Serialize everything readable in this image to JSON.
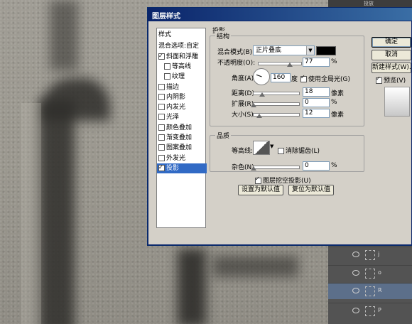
{
  "dialog": {
    "title": "图层样式"
  },
  "style_list": [
    {
      "label": "样式",
      "checkbox": false,
      "checked": false,
      "selected": false,
      "indent": false
    },
    {
      "label": "混合选项:自定",
      "checkbox": false,
      "checked": false,
      "selected": false,
      "indent": false
    },
    {
      "label": "斜面和浮雕",
      "checkbox": true,
      "checked": true,
      "selected": false,
      "indent": false
    },
    {
      "label": "等高线",
      "checkbox": true,
      "checked": false,
      "selected": false,
      "indent": true
    },
    {
      "label": "纹理",
      "checkbox": true,
      "checked": false,
      "selected": false,
      "indent": true
    },
    {
      "label": "描边",
      "checkbox": true,
      "checked": false,
      "selected": false,
      "indent": false
    },
    {
      "label": "内阴影",
      "checkbox": true,
      "checked": false,
      "selected": false,
      "indent": false
    },
    {
      "label": "内发光",
      "checkbox": true,
      "checked": false,
      "selected": false,
      "indent": false
    },
    {
      "label": "光泽",
      "checkbox": true,
      "checked": false,
      "selected": false,
      "indent": false
    },
    {
      "label": "颜色叠加",
      "checkbox": true,
      "checked": false,
      "selected": false,
      "indent": false
    },
    {
      "label": "渐变叠加",
      "checkbox": true,
      "checked": false,
      "selected": false,
      "indent": false
    },
    {
      "label": "图案叠加",
      "checkbox": true,
      "checked": false,
      "selected": false,
      "indent": false
    },
    {
      "label": "外发光",
      "checkbox": true,
      "checked": false,
      "selected": false,
      "indent": false
    },
    {
      "label": "投影",
      "checkbox": true,
      "checked": true,
      "selected": true,
      "indent": false
    }
  ],
  "drop_shadow": {
    "section_title": "投影",
    "structure_title": "结构",
    "blend_mode_label": "混合模式(B):",
    "blend_mode_value": "正片叠底",
    "shadow_color": "#000000",
    "opacity_label": "不透明度(O):",
    "opacity_value": "77",
    "opacity_unit": "%",
    "angle_label": "角度(A):",
    "angle_value": "160",
    "angle_unit": "度",
    "global_light_label": "使用全局光(G)",
    "global_light_checked": true,
    "distance_label": "距离(D):",
    "distance_value": "18",
    "distance_unit": "像素",
    "spread_label": "扩展(R):",
    "spread_value": "0",
    "spread_unit": "%",
    "size_label": "大小(S):",
    "size_value": "12",
    "size_unit": "像素",
    "quality_title": "品质",
    "contour_label": "等高线:",
    "anti_alias_label": "消除锯齿(L)",
    "noise_label": "杂色(N):",
    "noise_value": "0",
    "noise_unit": "%",
    "knockout_label": "图层挖空投影(U)",
    "knockout_checked": true,
    "make_default_label": "设置为默认值",
    "reset_default_label": "复位为默认值"
  },
  "buttons": {
    "ok": "确定",
    "cancel": "取消",
    "new_style": "新建样式(W)...",
    "preview_label": "预览(V)"
  },
  "layers": [
    {
      "name": "j",
      "selected": false
    },
    {
      "name": "o",
      "selected": false
    },
    {
      "name": "R",
      "selected": true
    },
    {
      "name": "P",
      "selected": false
    }
  ],
  "top_strip_text": "投放"
}
